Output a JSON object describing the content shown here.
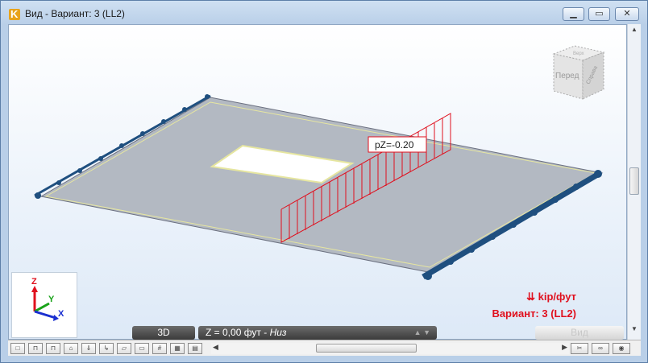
{
  "window": {
    "title": "Вид - Вариант: 3 (LL2)"
  },
  "viewport": {
    "load_label": "pZ=-0.20",
    "unit_label": "kip/фут",
    "variant_label": "Вариант: 3 (LL2)",
    "viewcube": {
      "front": "Перед",
      "right": "Справа",
      "top": "Верх"
    },
    "axes": {
      "x": "X",
      "y": "Y",
      "z": "Z"
    }
  },
  "statusbar": {
    "mode_button": "3D",
    "z_value": "Z = 0,00 фут - ",
    "z_side": "Низ",
    "view_button": "Вид"
  },
  "colors": {
    "load": "#e0101e",
    "slab": "#b3b9c2",
    "support": "#1f4f7f"
  }
}
